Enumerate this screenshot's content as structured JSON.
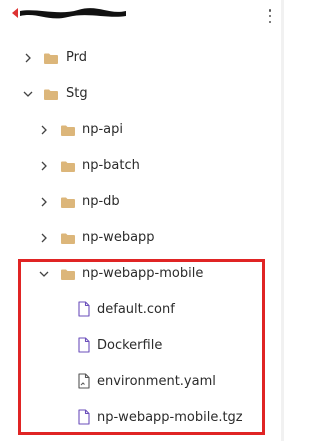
{
  "header": {
    "title_redacted": true,
    "more_icon": "vertical-ellipsis-icon"
  },
  "tree": {
    "items": [
      {
        "label": "Prd",
        "type": "folder",
        "expanded": false,
        "depth": 1
      },
      {
        "label": "Stg",
        "type": "folder",
        "expanded": true,
        "depth": 1
      },
      {
        "label": "np-api",
        "type": "folder",
        "expanded": false,
        "depth": 2
      },
      {
        "label": "np-batch",
        "type": "folder",
        "expanded": false,
        "depth": 2
      },
      {
        "label": "np-db",
        "type": "folder",
        "expanded": false,
        "depth": 2
      },
      {
        "label": "np-webapp",
        "type": "folder",
        "expanded": false,
        "depth": 2
      },
      {
        "label": "np-webapp-mobile",
        "type": "folder",
        "expanded": true,
        "depth": 2
      },
      {
        "label": "default.conf",
        "type": "file",
        "depth": 3
      },
      {
        "label": "Dockerfile",
        "type": "file",
        "depth": 3
      },
      {
        "label": "environment.yaml",
        "type": "file-modified",
        "depth": 3
      },
      {
        "label": "np-webapp-mobile.tgz",
        "type": "file",
        "depth": 3
      }
    ]
  },
  "colors": {
    "folder": "#dcb67a",
    "highlight_border": "#e02424",
    "text": "#2b2b2b",
    "icon_stroke": "#6b4fbb"
  }
}
